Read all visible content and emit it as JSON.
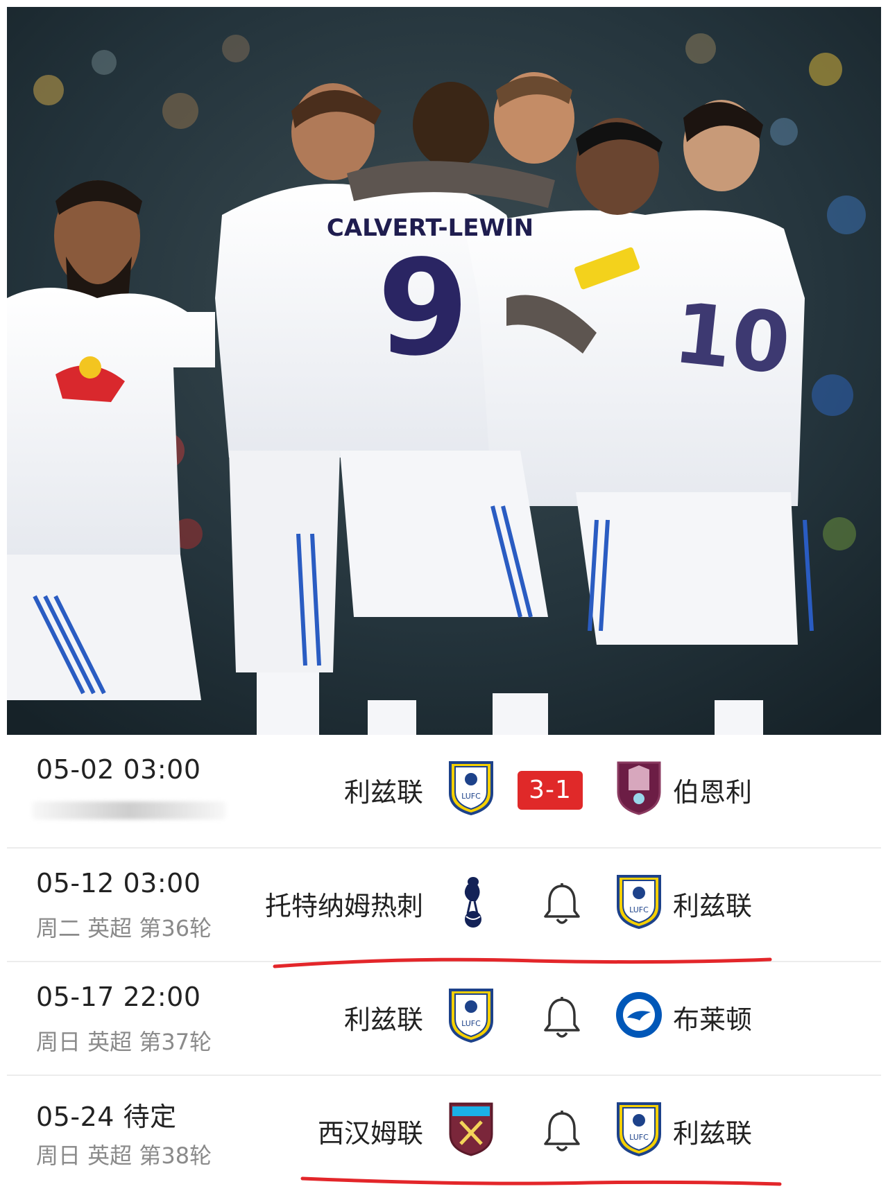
{
  "photo": {
    "jersey_name": "CALVERT-LEWIN",
    "jersey_number": "9",
    "partial_number": "10"
  },
  "matches": [
    {
      "datetime": "05-02 03:00",
      "meta": "",
      "home_team": "利兹联",
      "home_crest": "leeds-crest-icon",
      "away_team": "伯恩利",
      "away_crest": "burnley-crest-icon",
      "score": "3-1",
      "finished": true,
      "underlined": false
    },
    {
      "datetime": "05-12 03:00",
      "meta": "周二 英超 第36轮",
      "home_team": "托特纳姆热刺",
      "home_crest": "tottenham-crest-icon",
      "away_team": "利兹联",
      "away_crest": "leeds-crest-icon",
      "finished": false,
      "underlined": true
    },
    {
      "datetime": "05-17 22:00",
      "meta": "周日 英超 第37轮",
      "home_team": "利兹联",
      "home_crest": "leeds-crest-icon",
      "away_team": "布莱顿",
      "away_crest": "brighton-crest-icon",
      "finished": false,
      "underlined": false
    },
    {
      "datetime": "05-24 待定",
      "meta": "周日 英超 第38轮",
      "home_team": "西汉姆联",
      "home_crest": "westham-crest-icon",
      "away_team": "利兹联",
      "away_crest": "leeds-crest-icon",
      "finished": false,
      "underlined": true
    }
  ],
  "colors": {
    "score_bg": "#e02929",
    "underline": "#e3262a",
    "leeds_yellow": "#f5d000",
    "leeds_blue": "#1d428a"
  }
}
